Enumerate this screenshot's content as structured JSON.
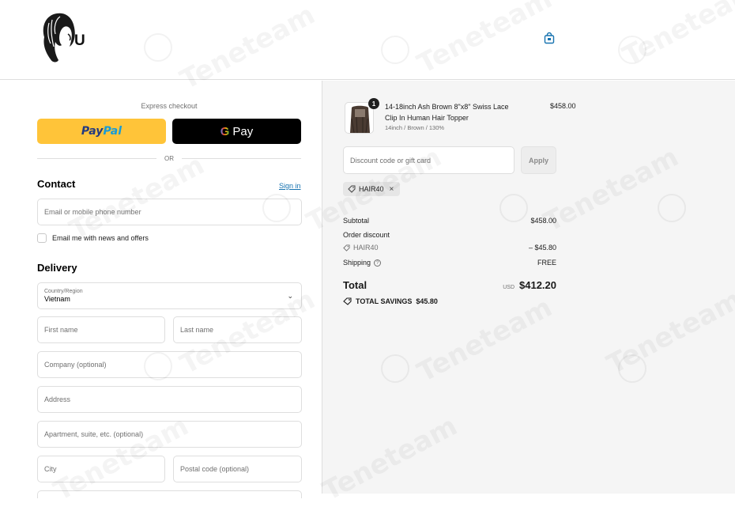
{
  "brand": {
    "logo_letter": "U"
  },
  "express": {
    "label": "Express checkout",
    "paypal_a": "Pay",
    "paypal_b": "Pal",
    "gpay_g": "G",
    "gpay_text": "Pay",
    "or_text": "OR"
  },
  "contact": {
    "heading": "Contact",
    "sign_in": "Sign in",
    "email_placeholder": "Email or mobile phone number",
    "newsletter_label": "Email me with news and offers"
  },
  "delivery": {
    "heading": "Delivery",
    "country_label": "Country/Region",
    "country_value": "Vietnam",
    "first_name": "First name",
    "last_name": "Last name",
    "company": "Company (optional)",
    "address": "Address",
    "apartment": "Apartment, suite, etc. (optional)",
    "city": "City",
    "postal": "Postal code (optional)"
  },
  "order": {
    "product_title": "14-18inch Ash Brown 8\"x8\" Swiss Lace Clip In Human Hair Topper",
    "product_variant": "14inch / Brown / 130%",
    "product_price": "$458.00",
    "quantity": "1",
    "discount_placeholder": "Discount code or gift card",
    "apply_label": "Apply",
    "applied_code": "HAIR40",
    "subtotal_label": "Subtotal",
    "subtotal_value": "$458.00",
    "order_discount_label": "Order discount",
    "discount_code": "HAIR40",
    "discount_value": "– $45.80",
    "shipping_label": "Shipping",
    "shipping_value": "FREE",
    "total_label": "Total",
    "currency": "USD",
    "total_value": "$412.20",
    "savings_label": "TOTAL SAVINGS",
    "savings_value": "$45.80"
  },
  "watermark": {
    "text": "Teneteam"
  },
  "colors": {
    "paypal": "#ffc439",
    "gpay": "#000000",
    "link": "#1773b0",
    "summary_bg": "#f5f5f5"
  }
}
